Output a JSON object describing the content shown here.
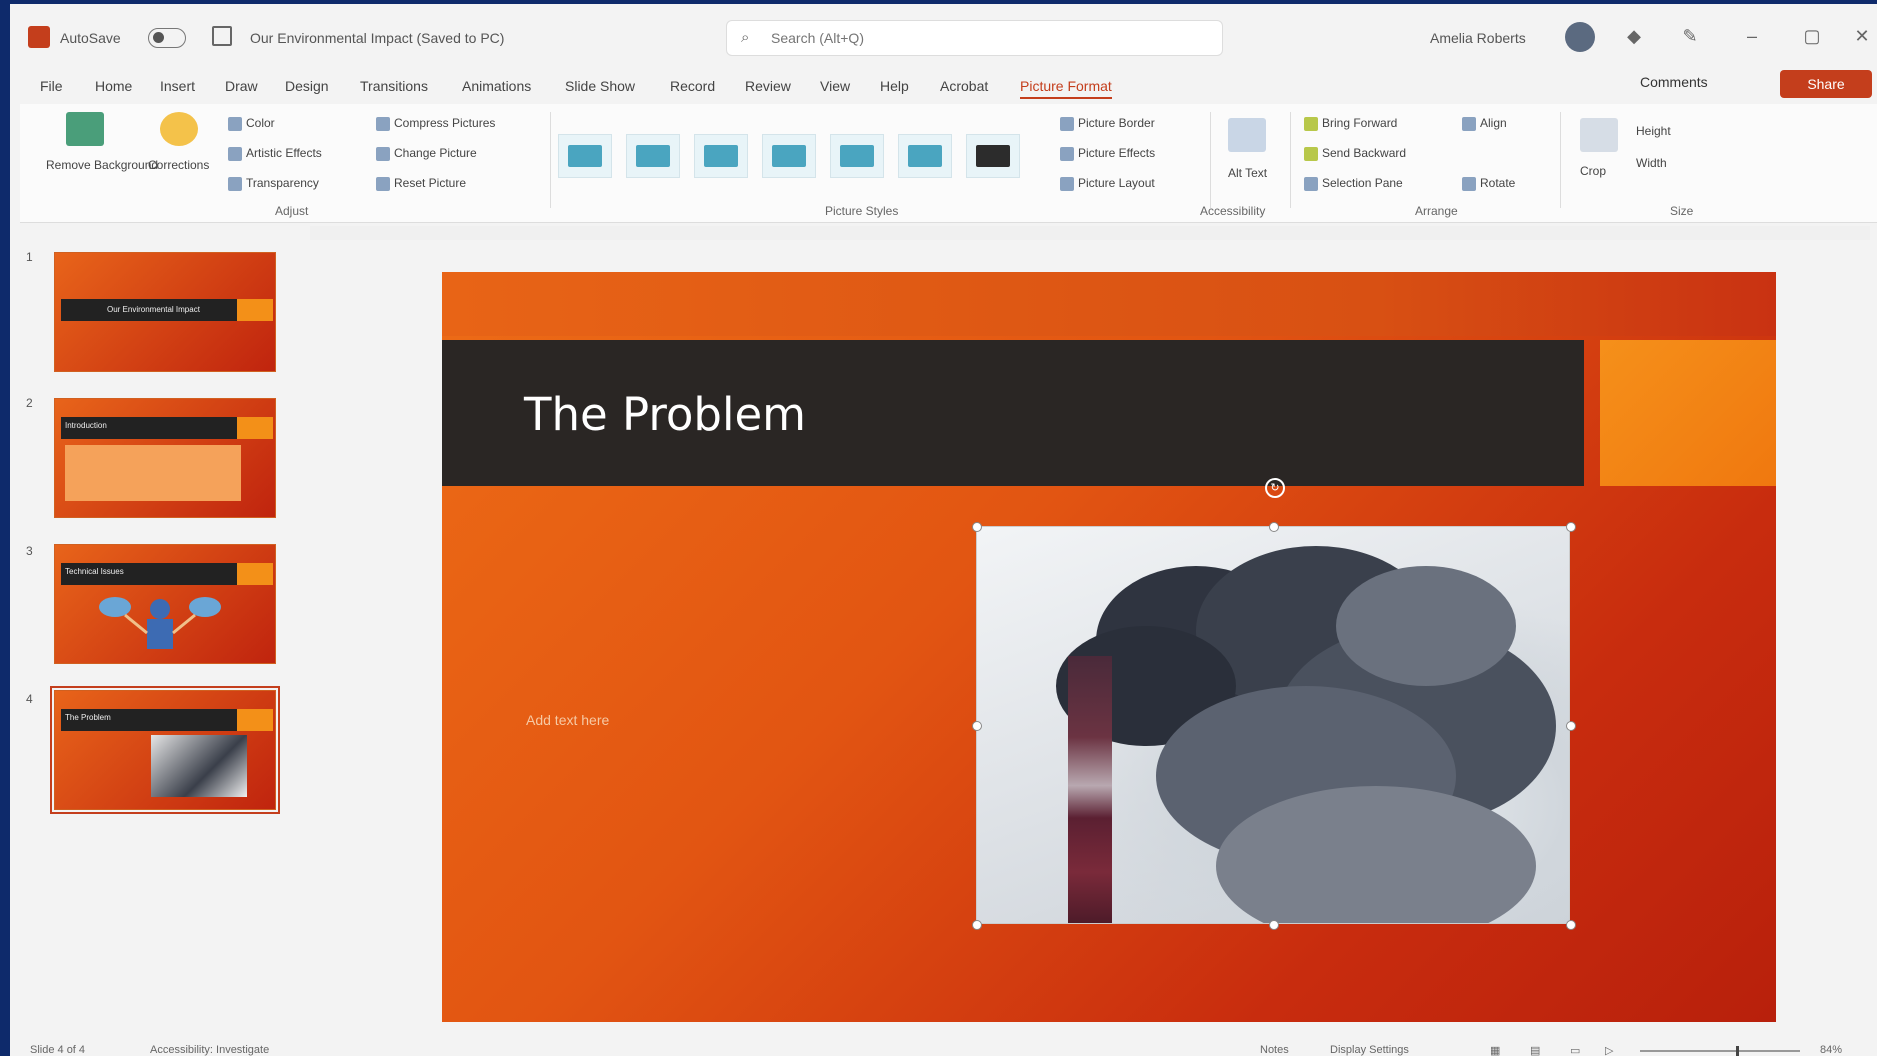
{
  "titlebar": {
    "autosave_label": "AutoSave",
    "doc_title": "Our Environmental Impact (Saved to PC)",
    "search_placeholder": "Search (Alt+Q)",
    "user_name": "Amelia Roberts"
  },
  "tabs": [
    "File",
    "Home",
    "Insert",
    "Draw",
    "Design",
    "Transitions",
    "Animations",
    "Slide Show",
    "Record",
    "Review",
    "View",
    "Help",
    "Acrobat",
    "Picture Format"
  ],
  "active_tab": "Picture Format",
  "comments_label": "Comments",
  "share_label": "Share",
  "ribbon": {
    "remove_background": "Remove Background",
    "corrections": "Corrections",
    "color": "Color",
    "artistic_effects": "Artistic Effects",
    "transparency": "Transparency",
    "compress_pictures": "Compress Pictures",
    "change_picture": "Change Picture",
    "reset_picture": "Reset Picture",
    "picture_border": "Picture Border",
    "picture_effects": "Picture Effects",
    "picture_layout": "Picture Layout",
    "alt_text": "Alt Text",
    "bring_forward": "Bring Forward",
    "send_backward": "Send Backward",
    "selection_pane": "Selection Pane",
    "align": "Align",
    "rotate": "Rotate",
    "crop": "Crop",
    "height": "Height",
    "width": "Width",
    "groups": {
      "adjust": "Adjust",
      "picture_styles": "Picture Styles",
      "accessibility": "Accessibility",
      "arrange": "Arrange",
      "size": "Size"
    }
  },
  "thumbnails": [
    {
      "num": "1",
      "title": "Our Environmental Impact"
    },
    {
      "num": "2",
      "title": "Introduction"
    },
    {
      "num": "3",
      "title": "Technical Issues"
    },
    {
      "num": "4",
      "title": "The Problem"
    }
  ],
  "slide": {
    "title": "The Problem",
    "subtitle": "Add text here"
  },
  "status": {
    "slide_count": "Slide 4 of 4",
    "accessibility": "Accessibility: Investigate",
    "notes": "Notes",
    "display_settings": "Display Settings",
    "zoom": "84%"
  },
  "colors": {
    "accent": "#c43e1c",
    "slide_orange": "#e86416",
    "slide_dark_bar": "#2a2624",
    "slide_gold": "#f5901a"
  }
}
